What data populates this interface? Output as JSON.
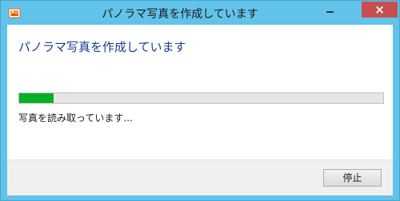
{
  "window": {
    "title": "パノラマ写真を作成しています",
    "close_glyph": "×",
    "accent_color": "#62c3ea",
    "close_color": "#c74f50"
  },
  "content": {
    "heading": "パノラマ写真を作成しています",
    "status": "写真を読み取っています...",
    "progress_fraction": 0.095,
    "progress_color": "#06b025"
  },
  "footer": {
    "stop_label": "停止"
  }
}
